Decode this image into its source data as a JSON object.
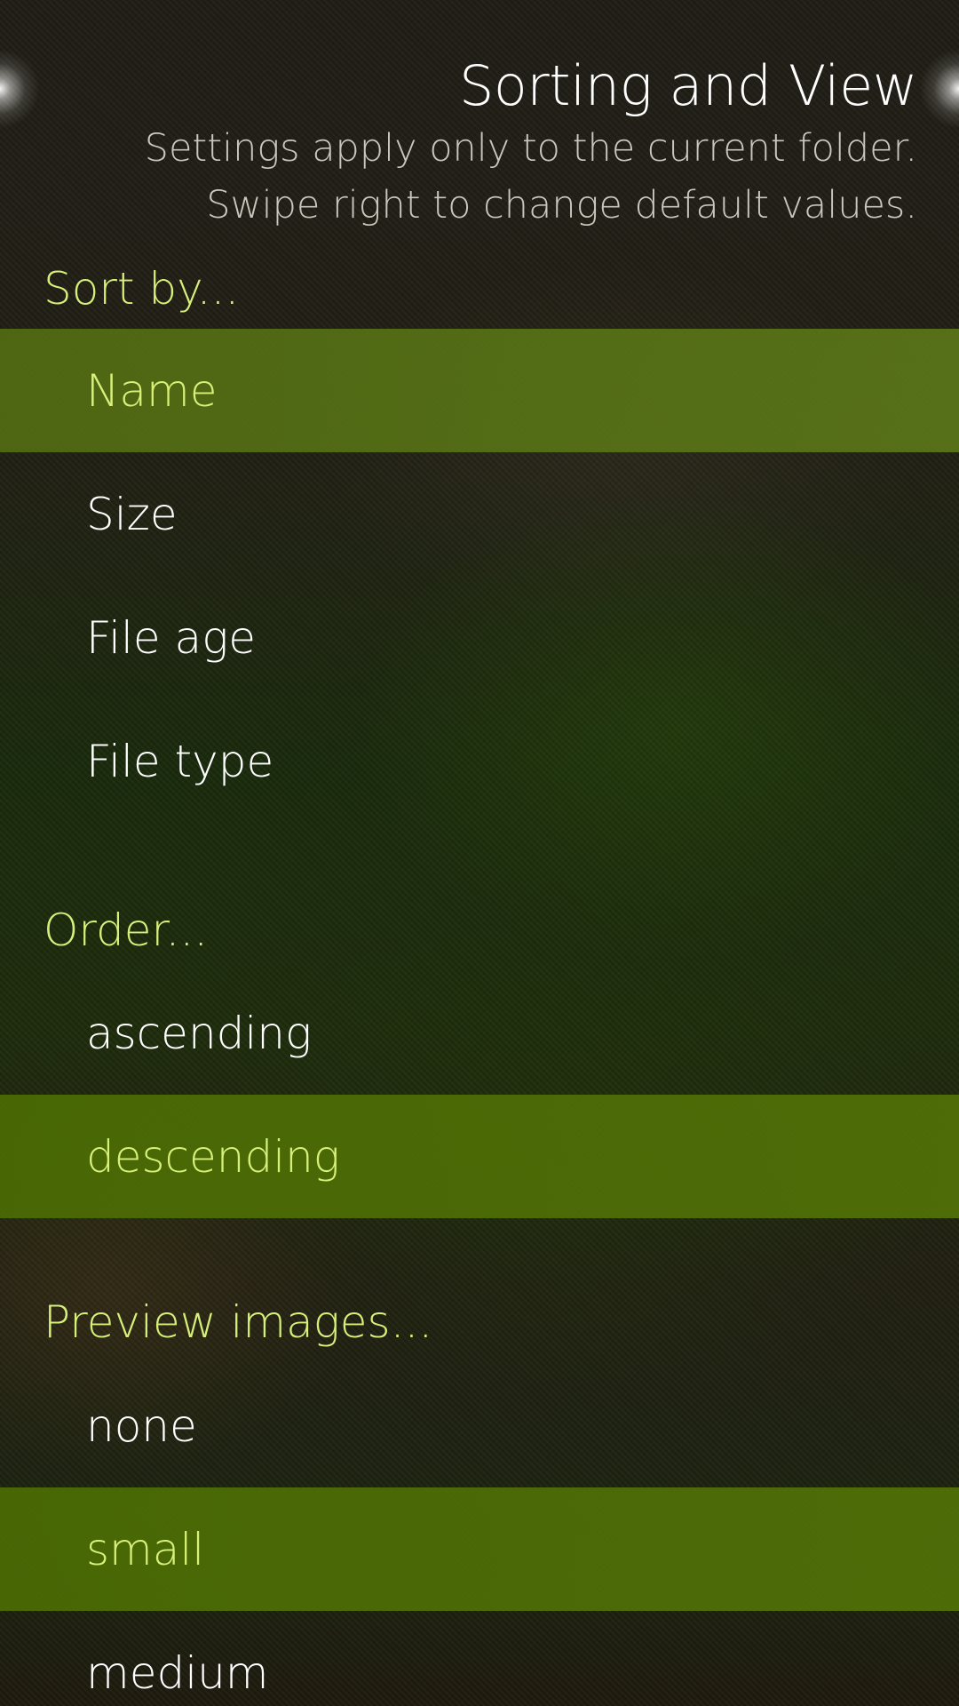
{
  "header": {
    "title": "Sorting and View",
    "description": "Settings apply only to the current folder. Swipe right to change default values."
  },
  "sort_by": {
    "label": "Sort by...",
    "options": [
      "Name",
      "Size",
      "File age",
      "File type"
    ],
    "selected": "Name"
  },
  "order": {
    "label": "Order...",
    "options": [
      "ascending",
      "descending"
    ],
    "selected": "descending"
  },
  "preview_images": {
    "label": "Preview images...",
    "options": [
      "none",
      "small",
      "medium"
    ],
    "selected": "small"
  },
  "colors": {
    "highlight_text": "#d7f07a",
    "selected_background": "#526c12",
    "text": "#ffffff"
  }
}
